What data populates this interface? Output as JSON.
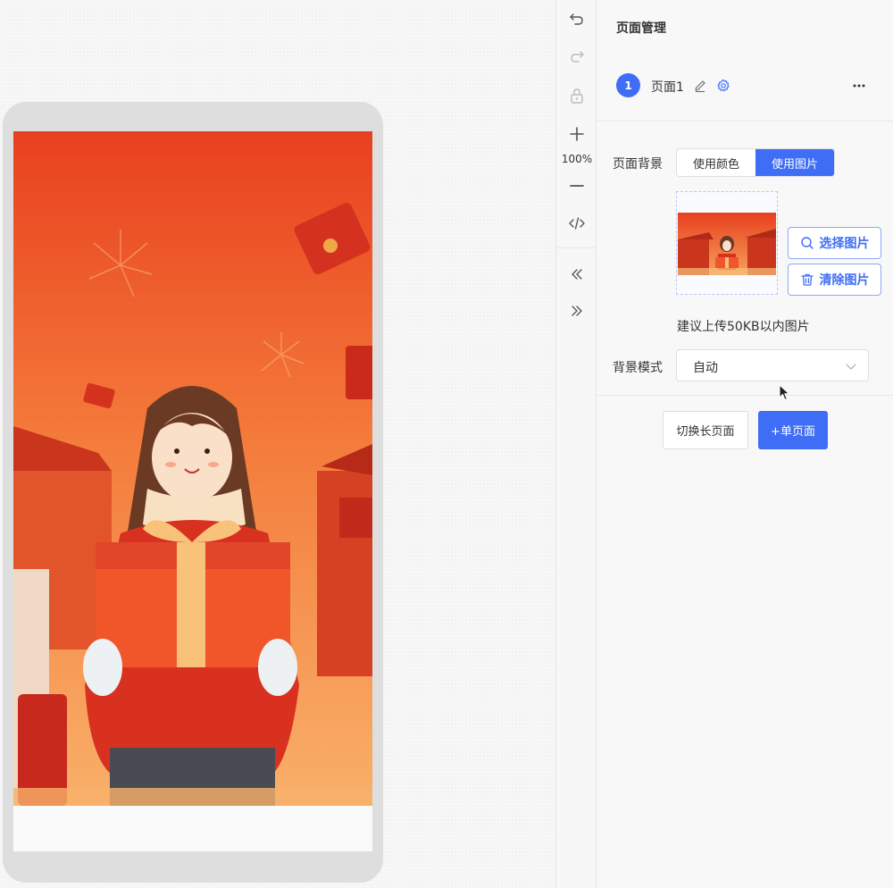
{
  "toolbar": {
    "zoom_level": "100%",
    "icons": [
      "undo-icon",
      "redo-icon",
      "lock-icon",
      "zoom-in-icon",
      "zoom-out-icon",
      "code-icon",
      "collapse-left-icon",
      "expand-right-icon"
    ]
  },
  "panel": {
    "title": "页面管理",
    "page": {
      "number": "1",
      "name": "页面1"
    },
    "background_label": "页面背景",
    "background_options": [
      "使用颜色",
      "使用图片"
    ],
    "background_selected": "使用图片",
    "select_image_label": "选择图片",
    "clear_image_label": "清除图片",
    "hint": "建议上传50KB以内图片",
    "mode_label": "背景模式",
    "mode_value": "自动",
    "switch_long_page_label": "切换长页面",
    "single_page_label": "+单页面"
  },
  "colors": {
    "accent": "#3f6df5",
    "poster_orange": "#f0562a",
    "poster_red": "#d8311f"
  }
}
